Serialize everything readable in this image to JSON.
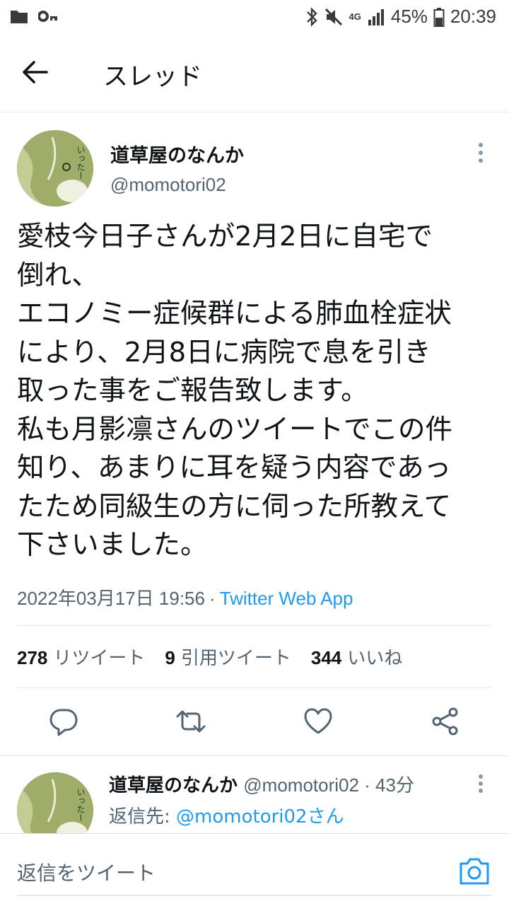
{
  "status_bar": {
    "network": "4G",
    "battery": "45%",
    "time": "20:39"
  },
  "header": {
    "title": "スレッド"
  },
  "tweet": {
    "author_name": "道草屋のなんか",
    "author_handle": "@momotori02",
    "avatar_text": "いったー",
    "text": "愛枝今日子さんが2月2日に自宅で\n倒れ、\nエコノミー症候群による肺血栓症状\nにより、2月8日に病院で息を引き\n取った事をご報告致します。\n私も月影凛さんのツイートでこの件\n知り、あまりに耳を疑う内容であっ\nたため同級生の方に伺った所教えて\n下さいました。",
    "timestamp": "2022年03月17日 19:56",
    "separator": "·",
    "client": "Twitter Web App",
    "retweets_count": "278",
    "retweets_label": "リツイート",
    "quotes_count": "9",
    "quotes_label": "引用ツイート",
    "likes_count": "344",
    "likes_label": "いいね"
  },
  "reply": {
    "author_name": "道草屋のなんか",
    "meta": "@momotori02 · 43分",
    "reply_to_label": "返信先:",
    "reply_to_mention": "@momotori02さん"
  },
  "composer": {
    "placeholder": "返信をツイート"
  },
  "colors": {
    "accent": "#1d9bf0",
    "secondary_text": "#536471",
    "avatar_bg": "#9fad6b"
  },
  "icons": [
    "folder-icon",
    "key-icon",
    "bluetooth-icon",
    "mute-icon",
    "signal-icon",
    "battery-icon",
    "back-arrow-icon",
    "more-vertical-icon",
    "reply-icon",
    "retweet-icon",
    "like-icon",
    "share-icon",
    "camera-icon"
  ]
}
